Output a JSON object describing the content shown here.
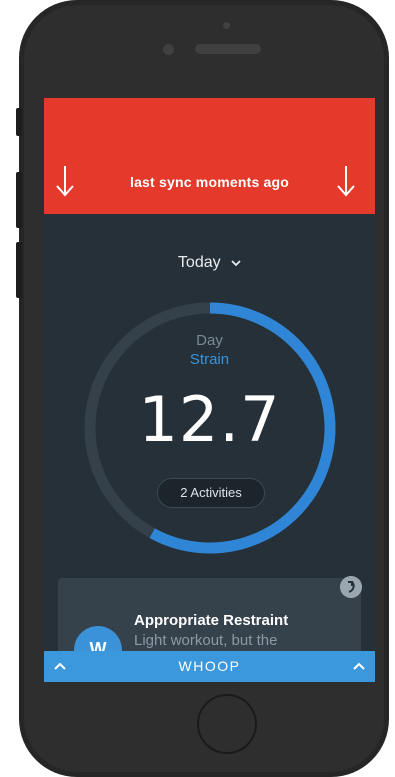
{
  "sync": {
    "text": "last sync moments ago"
  },
  "date_selector": {
    "label": "Today"
  },
  "strain": {
    "day_label": "Day",
    "strain_label": "Strain",
    "value": "12.7",
    "activities_label": "2 Activities",
    "gauge_fill_fraction": 0.58
  },
  "insight_card": {
    "title": "Appropriate Restraint",
    "body": "Light workout, but the",
    "icon_text": "W"
  },
  "bottom_bar": {
    "label": "WHOOP"
  },
  "colors": {
    "sync_bar": "#e53a2b",
    "screen_bg": "#263038",
    "accent_blue": "#3a92d8",
    "gauge_track": "#34414b"
  }
}
